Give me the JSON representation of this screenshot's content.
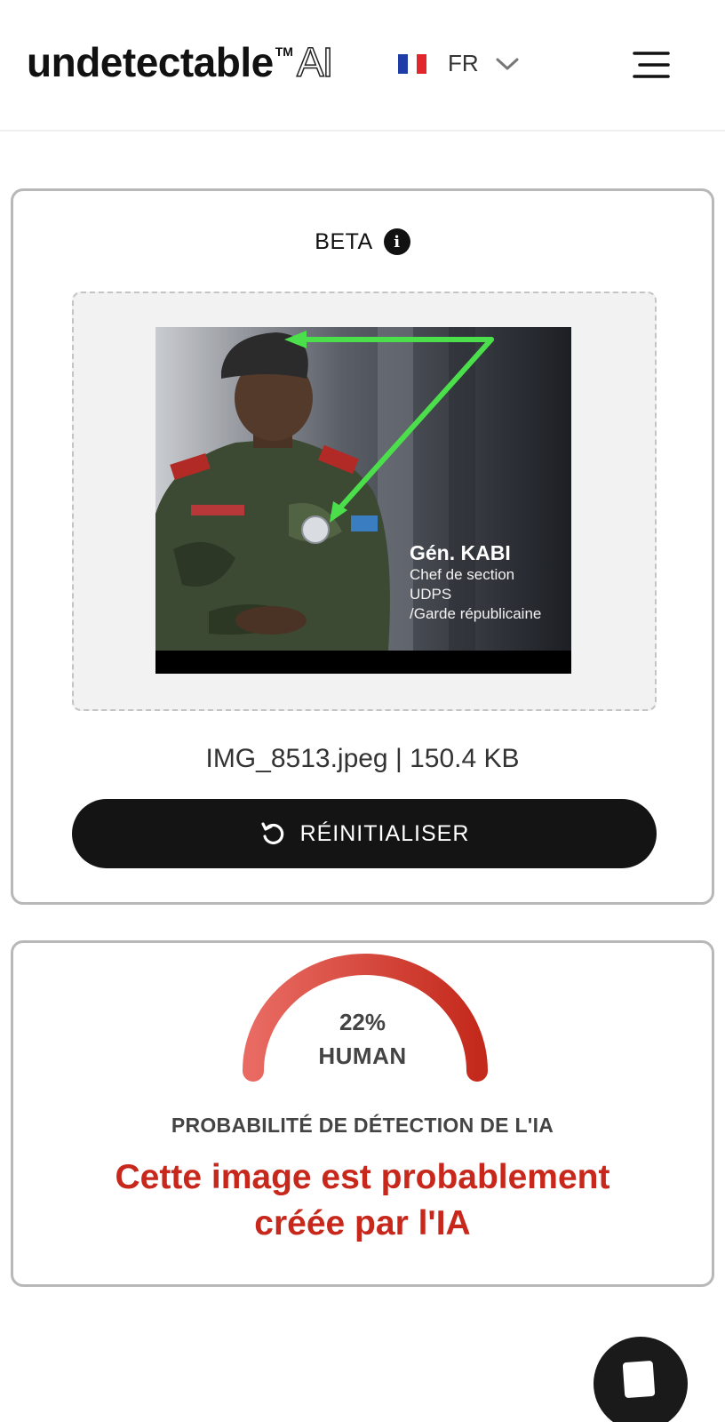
{
  "header": {
    "logo_word": "undetectable",
    "logo_tm": "TM",
    "logo_ai": "AI",
    "language_code": "FR",
    "flag_colors": [
      "#1f3da6",
      "#ffffff",
      "#e3262c"
    ]
  },
  "upload": {
    "beta_label": "BETA",
    "file_info": "IMG_8513.jpeg | 150.4 KB",
    "reset_label": "RÉINITIALISER",
    "image_caption": {
      "name": "Gén. KABI",
      "lines": [
        "Chef de section",
        "UDPS",
        "/Garde républicaine"
      ]
    }
  },
  "result": {
    "percent": "22%",
    "gauge_value": 0.22,
    "gauge_label": "HUMAN",
    "probability_label": "PROBABILITÉ DE DÉTECTION DE L'IA",
    "verdict_line1": "Cette image est probablement",
    "verdict_line2": "créée par l'IA",
    "accent_color": "#c8281c"
  },
  "icons": {
    "info": "info-icon",
    "reset": "reset-icon",
    "menu": "menu-icon",
    "chevron": "chevron-down-icon",
    "chat": "chat-icon"
  }
}
